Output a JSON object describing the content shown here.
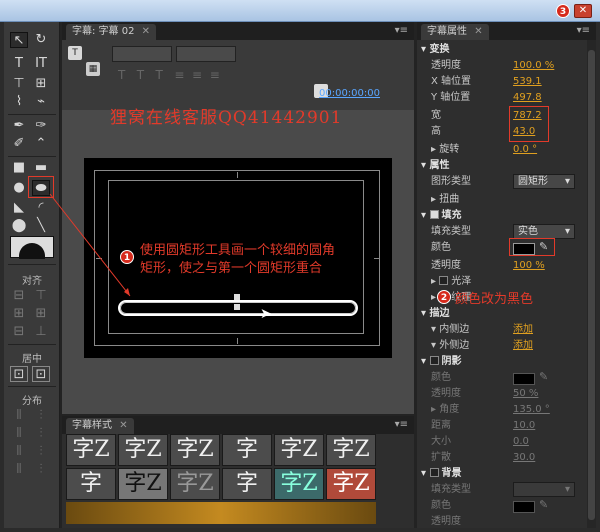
{
  "window": {
    "close_badge": "3"
  },
  "tools": {
    "align_label": "对齐",
    "center_label": "居中",
    "distribute_label": "分布"
  },
  "main": {
    "tab_title": "字幕: 字幕 02",
    "timecode": "00:00:00:00"
  },
  "watermark": "狸窝在线客服QQ41442901",
  "annotations": {
    "a1_badge": "1",
    "a1_text_line1": "使用圆矩形工具画一个较细的圆角",
    "a1_text_line2": "矩形，使之与第一个圆矩形重合",
    "a2_badge": "2",
    "a2_text": "颜色改为黑色"
  },
  "styles_panel": {
    "tab_title": "字幕样式",
    "swatches": [
      "字Z",
      "字Z",
      "字Z",
      "字",
      "字Z",
      "字Z",
      "字",
      "字Z",
      "字Z",
      "字",
      "字Z",
      "字Z"
    ]
  },
  "props": {
    "tab_title": "字幕属性",
    "transform_header": "变换",
    "opacity_label": "透明度",
    "opacity_value": "100.0 %",
    "x_label": "X 轴位置",
    "x_value": "539.1",
    "y_label": "Y 轴位置",
    "y_value": "497.8",
    "width_label": "宽",
    "width_value": "787.2",
    "height_label": "高",
    "height_value": "43.0",
    "rotate_label": "旋转",
    "rotate_value": "0.0 °",
    "attr_header": "属性",
    "graphic_type_label": "图形类型",
    "graphic_type_value": "圆矩形",
    "distort_label": "扭曲",
    "fill_header": "填充",
    "fill_type_label": "填充类型",
    "fill_type_value": "实色",
    "color_label": "颜色",
    "fill_opacity_label": "透明度",
    "fill_opacity_value": "100 %",
    "sheen_label": "光泽",
    "texture_label": "纹理",
    "stroke_header": "描边",
    "inner_stroke_label": "内侧边",
    "inner_stroke_action": "添加",
    "outer_stroke_label": "外侧边",
    "outer_stroke_action": "添加",
    "shadow_header": "阴影",
    "shadow_color_label": "颜色",
    "shadow_opacity_label": "透明度",
    "shadow_opacity_value": "50 %",
    "shadow_angle_label": "角度",
    "shadow_angle_value": "135.0 °",
    "shadow_distance_label": "距离",
    "shadow_distance_value": "10.0",
    "shadow_size_label": "大小",
    "shadow_size_value": "0.0",
    "shadow_spread_label": "扩散",
    "shadow_spread_value": "30.0",
    "bg_header": "背景",
    "bg_fill_type_label": "填充类型",
    "bg_color_label": "颜色",
    "bg_opacity_label": "透明度"
  },
  "colors": {
    "accent_value": "#e0a020",
    "annotation": "#e23a2a",
    "timecode": "#5aa6ff"
  }
}
